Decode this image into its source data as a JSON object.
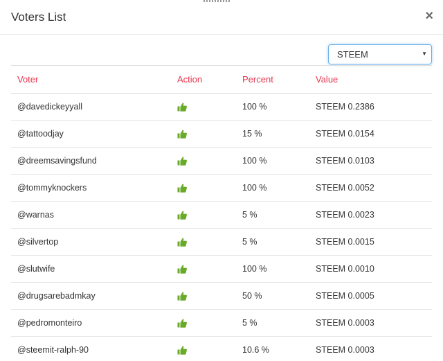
{
  "modal": {
    "title": "Voters List",
    "close_label": "×"
  },
  "currency_select": {
    "value": "STEEM",
    "caret": "▼"
  },
  "table": {
    "headers": {
      "voter": "Voter",
      "action": "Action",
      "percent": "Percent",
      "value": "Value"
    },
    "rows": [
      {
        "voter": "@davedickeyyall",
        "action_icon": "thumbs-up-icon",
        "percent": "100 %",
        "value": "STEEM 0.2386"
      },
      {
        "voter": "@tattoodjay",
        "action_icon": "thumbs-up-icon",
        "percent": "15 %",
        "value": "STEEM 0.0154"
      },
      {
        "voter": "@dreemsavingsfund",
        "action_icon": "thumbs-up-icon",
        "percent": "100 %",
        "value": "STEEM 0.0103"
      },
      {
        "voter": "@tommyknockers",
        "action_icon": "thumbs-up-icon",
        "percent": "100 %",
        "value": "STEEM 0.0052"
      },
      {
        "voter": "@warnas",
        "action_icon": "thumbs-up-icon",
        "percent": "5 %",
        "value": "STEEM 0.0023"
      },
      {
        "voter": "@silvertop",
        "action_icon": "thumbs-up-icon",
        "percent": "5 %",
        "value": "STEEM 0.0015"
      },
      {
        "voter": "@slutwife",
        "action_icon": "thumbs-up-icon",
        "percent": "100 %",
        "value": "STEEM 0.0010"
      },
      {
        "voter": "@drugsarebadmkay",
        "action_icon": "thumbs-up-icon",
        "percent": "50 %",
        "value": "STEEM 0.0005"
      },
      {
        "voter": "@pedromonteiro",
        "action_icon": "thumbs-up-icon",
        "percent": "5 %",
        "value": "STEEM 0.0003"
      },
      {
        "voter": "@steemit-ralph-90",
        "action_icon": "thumbs-up-icon",
        "percent": "10.6 %",
        "value": "STEEM 0.0003"
      }
    ]
  },
  "colors": {
    "accent": "#e8344e",
    "upvote": "#6aaa2a"
  }
}
